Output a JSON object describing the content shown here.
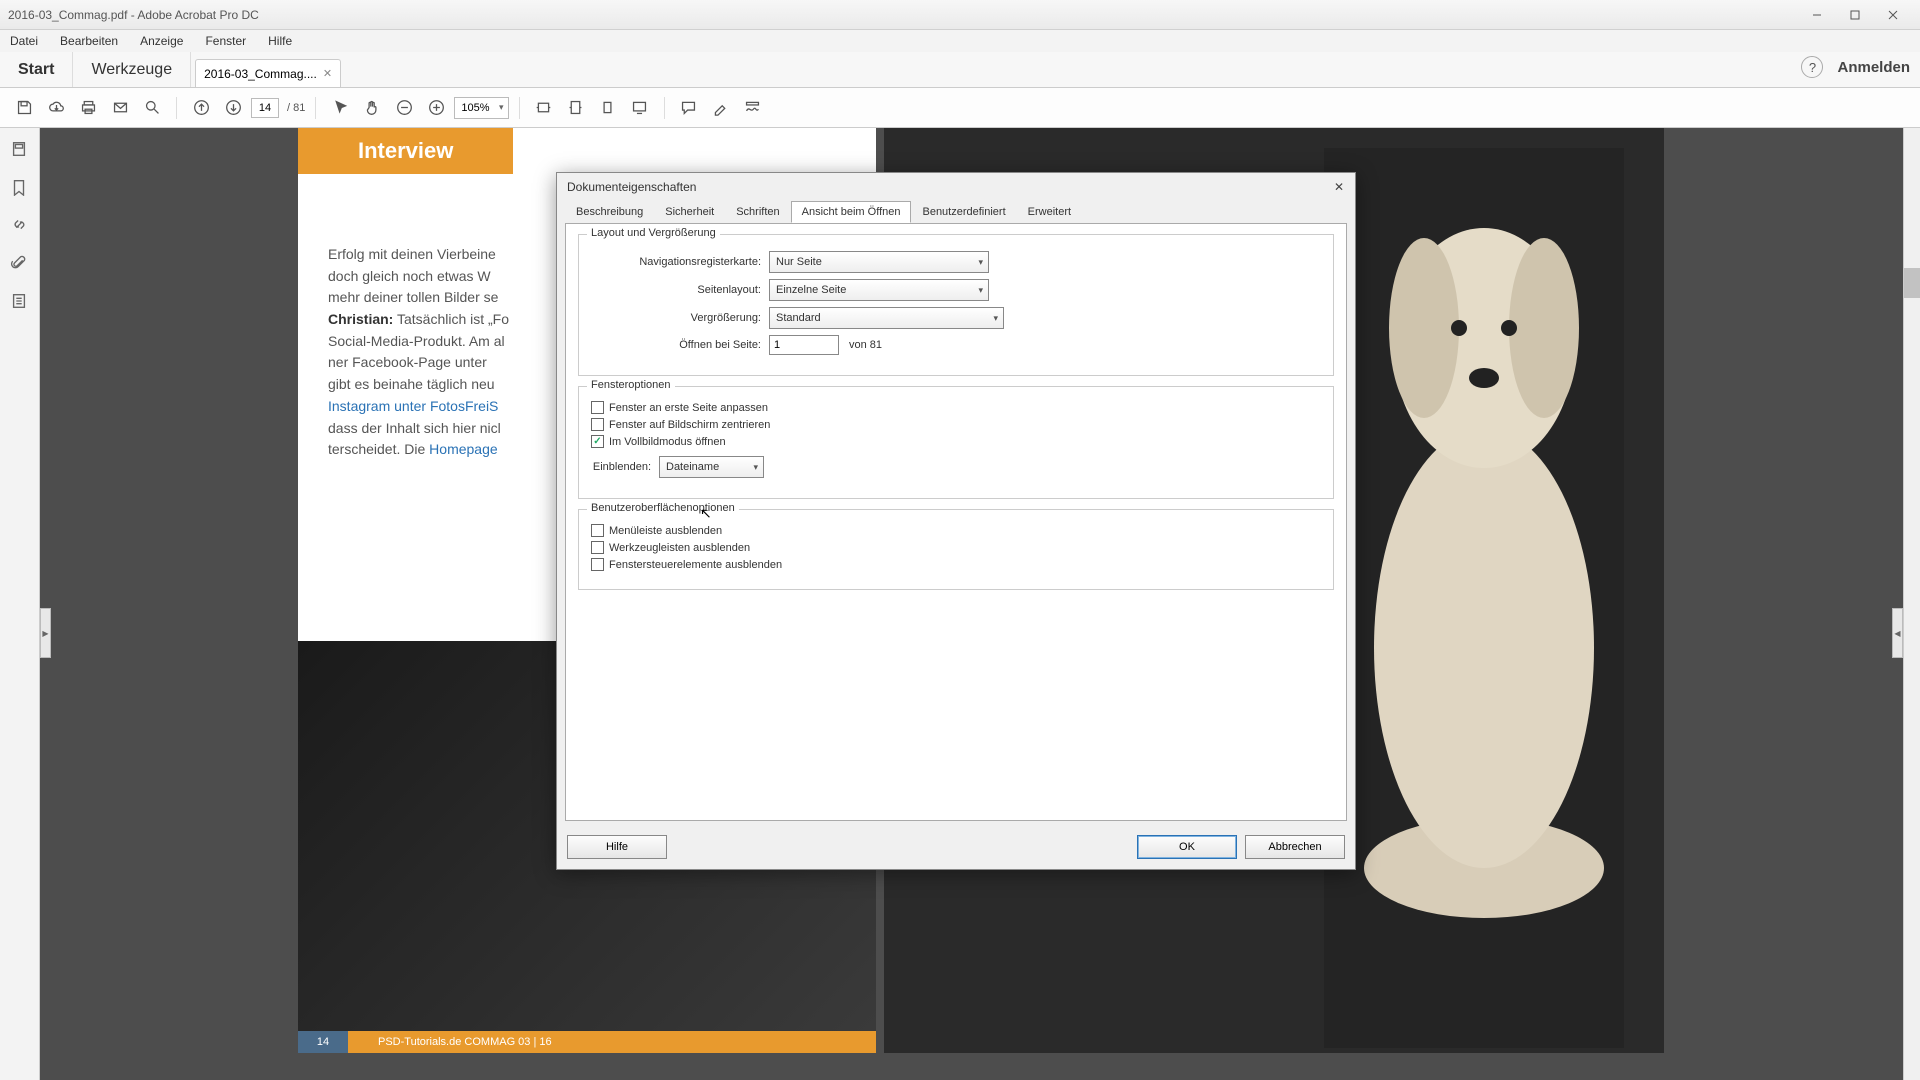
{
  "window": {
    "title": "2016-03_Commag.pdf - Adobe Acrobat Pro DC"
  },
  "menu": {
    "file": "Datei",
    "edit": "Bearbeiten",
    "view": "Anzeige",
    "window": "Fenster",
    "help": "Hilfe"
  },
  "tabs": {
    "start": "Start",
    "tools": "Werkzeuge",
    "doc": "2016-03_Commag....",
    "signin": "Anmelden"
  },
  "toolbar": {
    "page_current": "14",
    "page_total": "/ 81",
    "zoom": "105%"
  },
  "doc": {
    "interview": "Interview",
    "text1": "Erfolg mit deinen Vierbeine",
    "text2": "doch gleich noch etwas W",
    "text3": "mehr deiner tollen Bilder se",
    "christian_label": "Christian:",
    "text4": " Tatsächlich ist „Fo",
    "text5": "Social-Media-Produkt. Am al",
    "text6": "ner  Facebook-Page  unter ",
    "text7": "gibt es beinahe täglich neu",
    "link1": "Instagram  unter  FotosFreiS",
    "text8": "dass der Inhalt sich hier nicl",
    "text9": "terscheidet. Die ",
    "link2": "Homepage",
    "footer_page": "14",
    "footer_text": "PSD-Tutorials.de   COMMAG 03 | 16"
  },
  "dialog": {
    "title": "Dokumenteigenschaften",
    "tabs": {
      "desc": "Beschreibung",
      "security": "Sicherheit",
      "fonts": "Schriften",
      "initial": "Ansicht beim Öffnen",
      "custom": "Benutzerdefiniert",
      "advanced": "Erweitert"
    },
    "group_layout": "Layout und Vergrößerung",
    "nav_label": "Navigationsregisterkarte:",
    "nav_value": "Nur Seite",
    "pagelayout_label": "Seitenlayout:",
    "pagelayout_value": "Einzelne Seite",
    "mag_label": "Vergrößerung:",
    "mag_value": "Standard",
    "openpage_label": "Öffnen bei Seite:",
    "openpage_value": "1",
    "openpage_of": "von 81",
    "group_window": "Fensteroptionen",
    "chk_fit": "Fenster an erste Seite anpassen",
    "chk_center": "Fenster auf Bildschirm zentrieren",
    "chk_full": "Im Vollbildmodus öffnen",
    "show_label": "Einblenden:",
    "show_value": "Dateiname",
    "group_ui": "Benutzeroberflächenoptionen",
    "chk_menubar": "Menüleiste ausblenden",
    "chk_toolbars": "Werkzeugleisten ausblenden",
    "chk_controls": "Fenstersteuerelemente ausblenden",
    "btn_help": "Hilfe",
    "btn_ok": "OK",
    "btn_cancel": "Abbrechen"
  }
}
